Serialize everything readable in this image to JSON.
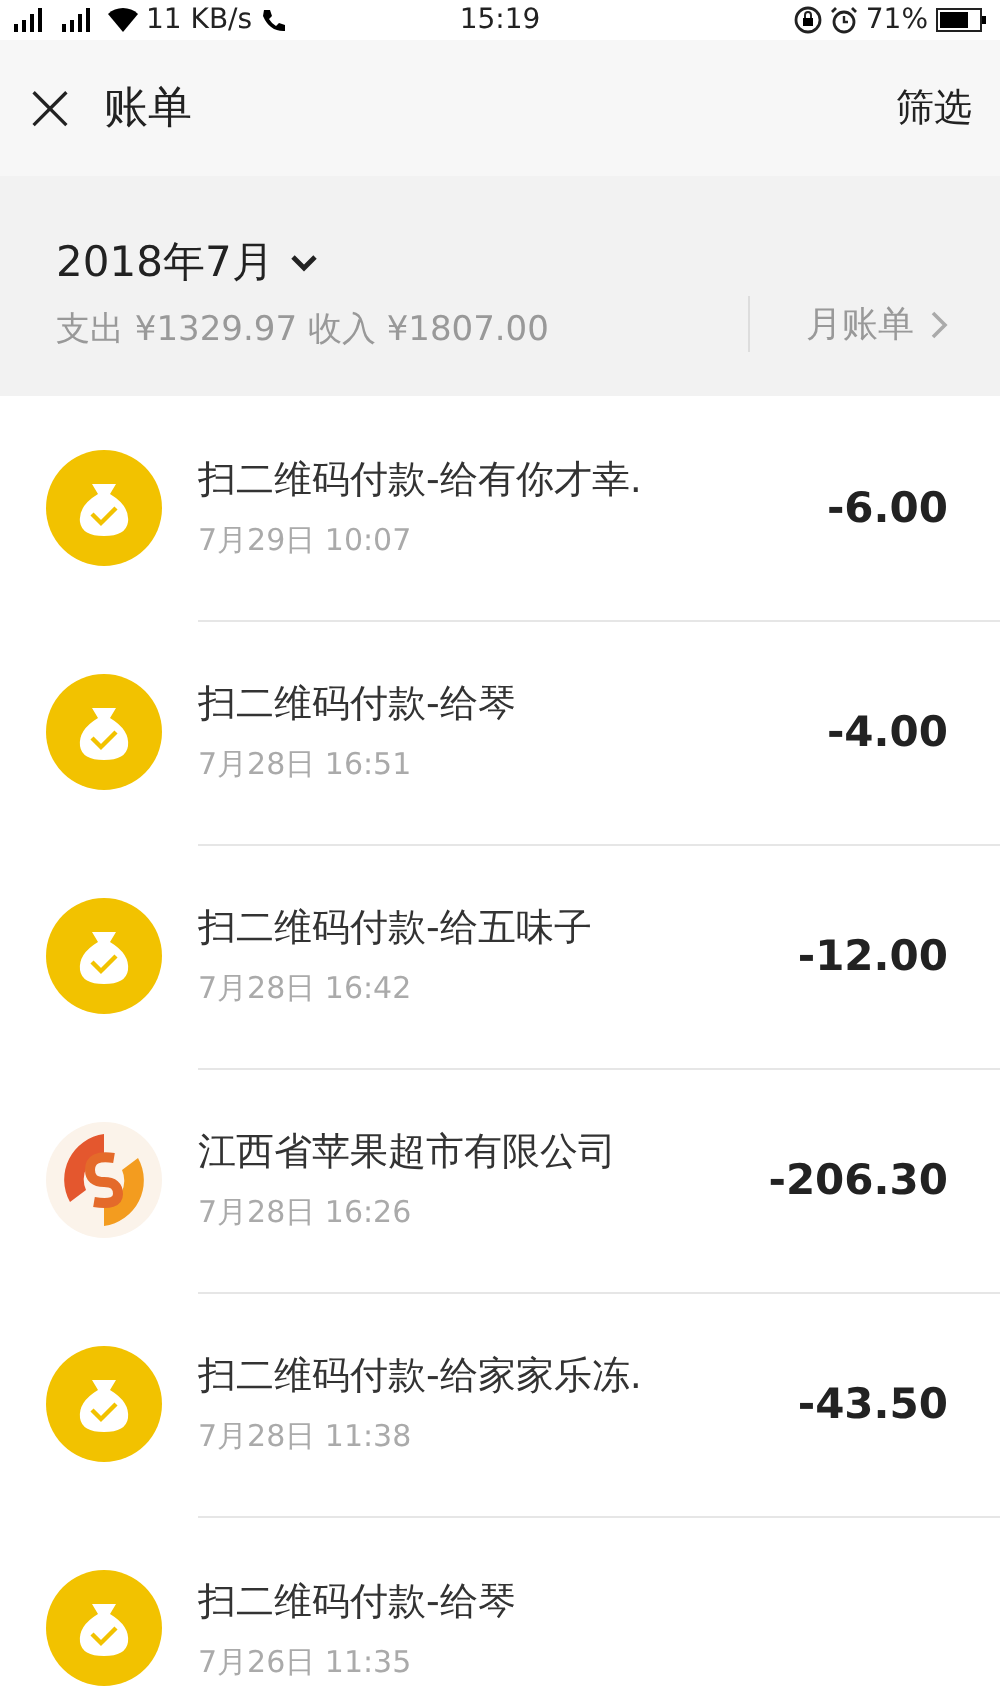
{
  "status_bar": {
    "speed": "11 KB/s",
    "time": "15:19",
    "battery": "71%"
  },
  "header": {
    "close_icon": "×",
    "title": "账单",
    "action": "筛选"
  },
  "summary": {
    "month": "2018年7月",
    "totals": "支出 ¥1329.97 收入 ¥1807.00",
    "monthly_bill": "月账单"
  },
  "transactions": [
    {
      "kind": "wallet",
      "title": "扫二维码付款-给有你才幸.",
      "time": "7月29日 10:07",
      "amount": "-6.00"
    },
    {
      "kind": "wallet",
      "title": "扫二维码付款-给琴",
      "time": "7月28日 16:51",
      "amount": "-4.00"
    },
    {
      "kind": "wallet",
      "title": "扫二维码付款-给五味子",
      "time": "7月28日 16:42",
      "amount": "-12.00"
    },
    {
      "kind": "merchant",
      "title": "江西省苹果超市有限公司",
      "time": "7月28日 16:26",
      "amount": "-206.30"
    },
    {
      "kind": "wallet",
      "title": "扫二维码付款-给家家乐冻.",
      "time": "7月28日 11:38",
      "amount": "-43.50"
    },
    {
      "kind": "wallet",
      "title": "扫二维码付款-给琴",
      "time": "7月26日 11:35"
    }
  ]
}
